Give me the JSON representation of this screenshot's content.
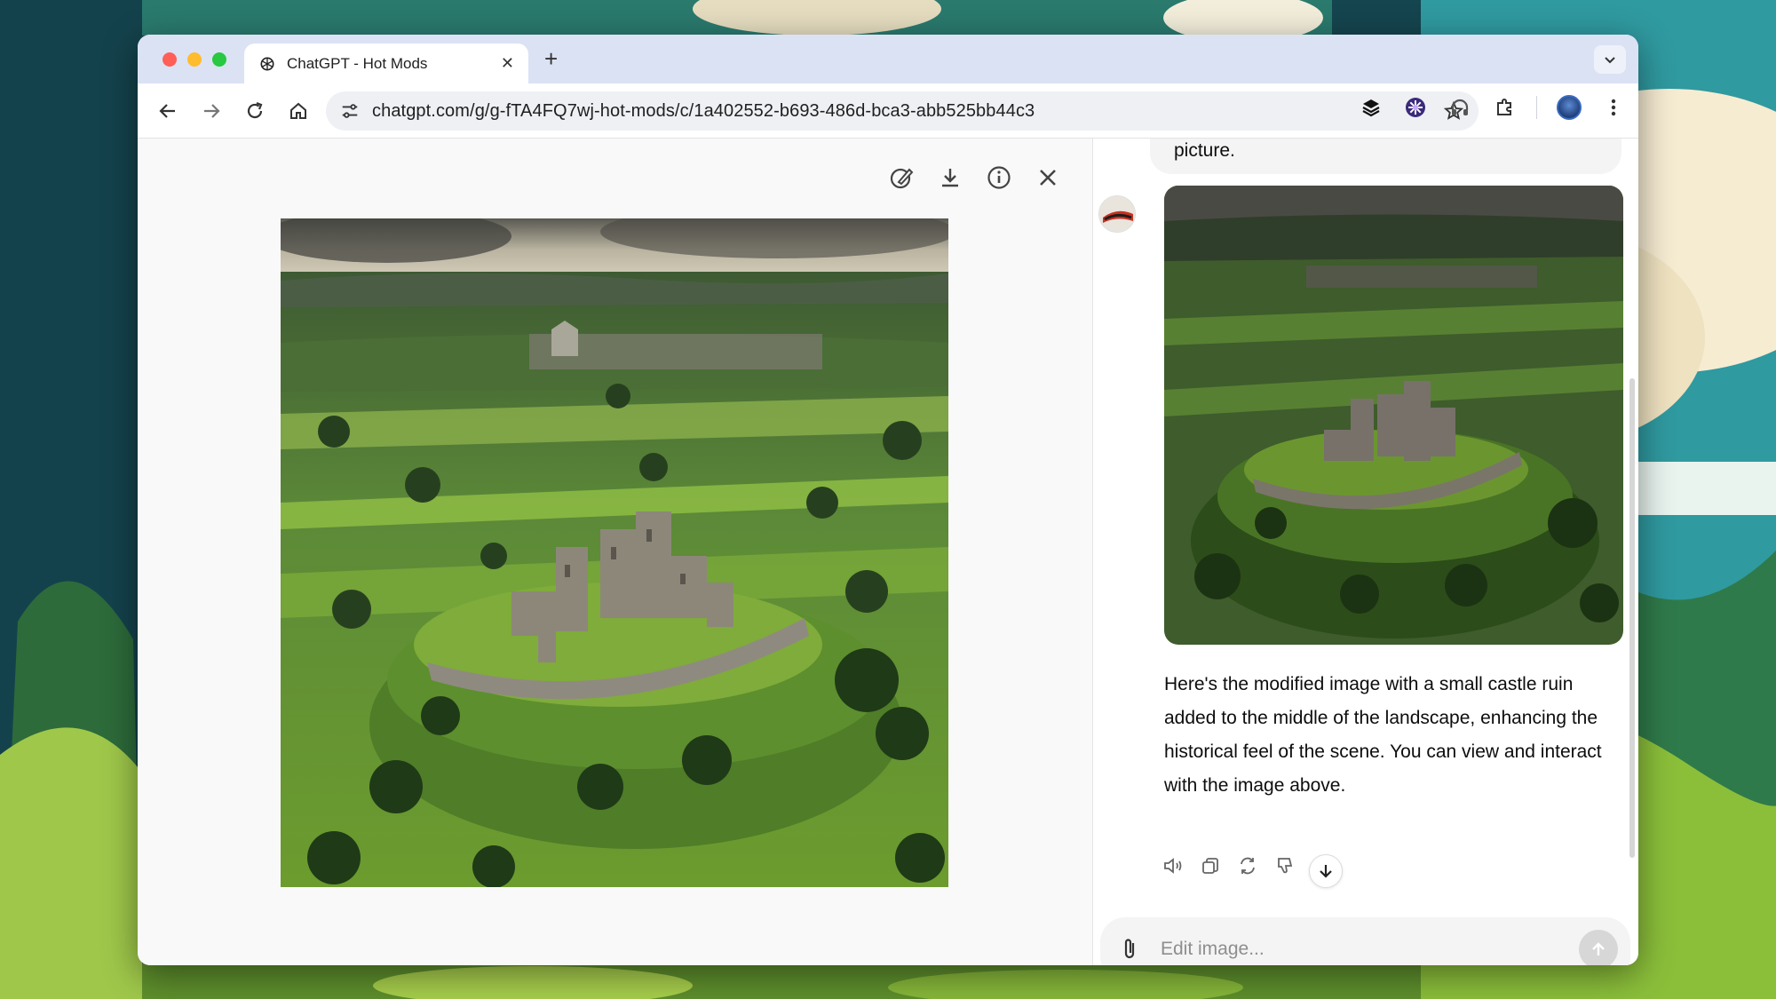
{
  "browser": {
    "tab_title": "ChatGPT - Hot Mods",
    "url": "chatgpt.com/g/g-fTA4FQ7wj-hot-mods/c/1a402552-b693-486d-bca3-abb525bb44c3",
    "icons": {
      "back": "arrow-left-icon",
      "forward": "arrow-right-icon",
      "reload": "reload-icon",
      "home": "home-icon",
      "site_settings": "tune-icon",
      "bookmark": "star-icon",
      "extensions": [
        "layers-icon",
        "flower-icon",
        "headphones-icon",
        "puzzle-icon"
      ],
      "menu": "kebab-menu-icon"
    }
  },
  "viewer": {
    "actions": [
      "edit-selection-icon",
      "download-icon",
      "info-icon",
      "close-icon"
    ],
    "image_subject": "castle-ruin-landscape"
  },
  "chat": {
    "user_message_tail": "picture.",
    "assistant_message": "Here's the modified image with a small castle ruin added to the middle of the landscape, enhancing the historical feel of the scene. You can view and interact with the image above.",
    "message_actions": [
      "read-aloud-icon",
      "copy-icon",
      "regenerate-icon",
      "thumbs-down-icon"
    ],
    "composer": {
      "placeholder": "Edit image..."
    }
  },
  "colors": {
    "tab_strip": "#dbe2f4",
    "page_bg": "#f9f9f9",
    "bubble": "#f4f4f4",
    "send_disabled": "#d7d7d7"
  }
}
